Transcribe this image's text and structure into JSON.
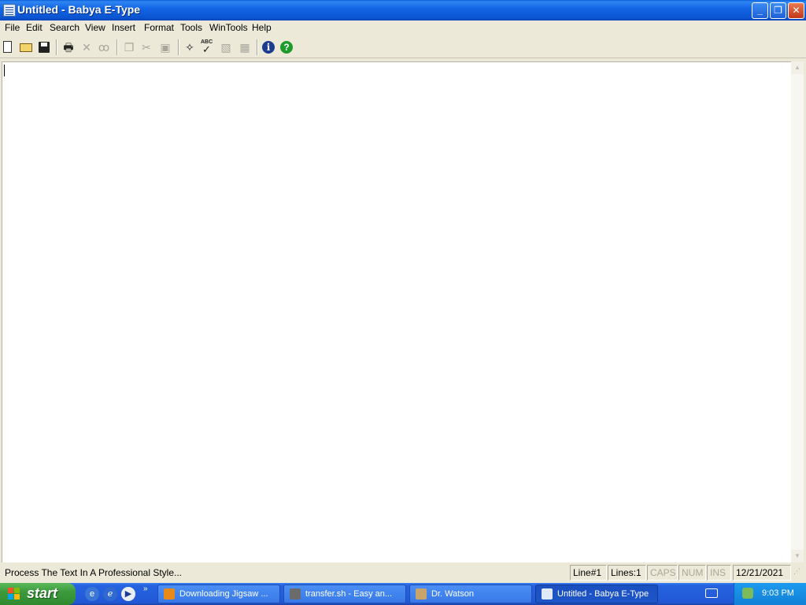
{
  "window": {
    "title": "Untitled - Babya E-Type",
    "minimize_glyph": "_",
    "maximize_glyph": "❐",
    "close_glyph": "✕"
  },
  "menu": {
    "items": [
      "File",
      "Edit",
      "Search",
      "View",
      "Insert",
      "Format",
      "Tools",
      "WinTools",
      "Help"
    ]
  },
  "toolbar": {
    "icons": [
      "new-document-icon",
      "open-folder-icon",
      "save-icon",
      "print-icon",
      "delete-icon",
      "find-binoculars-icon",
      "copy-icon",
      "cut-icon",
      "paste-icon",
      "magic-wand-icon",
      "spell-check-icon",
      "replace-icon",
      "document-properties-icon",
      "info-icon",
      "help-icon"
    ],
    "spell_label": "ABC",
    "info_glyph": "i",
    "help_glyph": "?"
  },
  "editor": {
    "content": ""
  },
  "status": {
    "message": "Process The Text In A Professional Style...",
    "line": "Line#1",
    "lines": "Lines:1",
    "caps": "CAPS",
    "num": "NUM",
    "ins": "INS",
    "date": "12/21/2021"
  },
  "taskbar": {
    "start_label": "start",
    "quick_launch": [
      "ie-icon",
      "ie-edge-icon",
      "media-player-icon"
    ],
    "tasks": [
      {
        "label": "Downloading Jigsaw ...",
        "icon": "firefox-icon",
        "active": false
      },
      {
        "label": "transfer.sh - Easy an...",
        "icon": "raccoon-icon",
        "active": false
      },
      {
        "label": "Dr. Watson",
        "icon": "dr-watson-icon",
        "active": false
      },
      {
        "label": "Untitled - Babya E-Type",
        "icon": "babya-etype-icon",
        "active": true
      }
    ],
    "clock": "9:03 PM"
  },
  "colors": {
    "title_bar": "#0a54d0",
    "taskbar": "#245edb",
    "start_button": "#3c9a3c",
    "tray": "#1181d8",
    "chrome": "#ece9d8"
  }
}
